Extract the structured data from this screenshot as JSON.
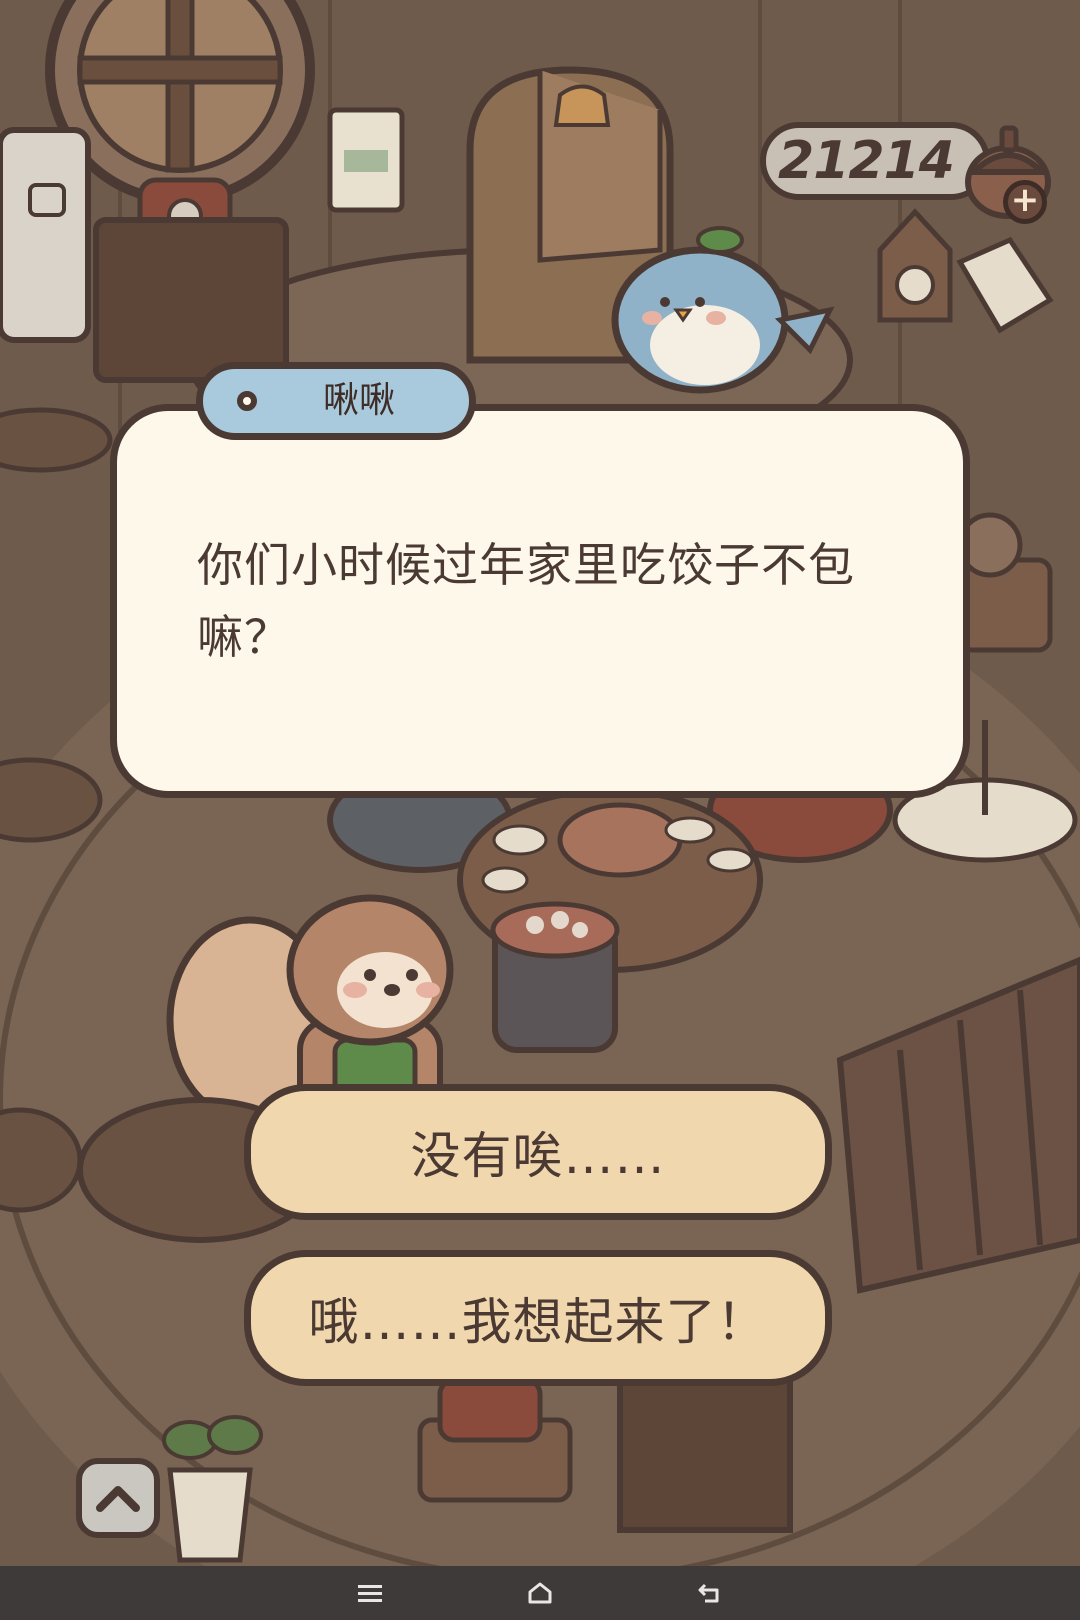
{
  "hud": {
    "currency": "21214",
    "add_button_label": "+",
    "currency_icon": "acorn-icon"
  },
  "dialog": {
    "speaker": "啾啾",
    "text": "你们小时候过年家里吃饺子不包嘛？"
  },
  "choices": [
    {
      "label": "没有唉……"
    },
    {
      "label": "哦……我想起来了！"
    }
  ],
  "expand_icon": "chevron-up-icon",
  "nav_bar": {
    "menu_icon": "menu-icon",
    "home_icon": "home-icon",
    "back_icon": "back-icon"
  },
  "colors": {
    "outline": "#4b3a33",
    "dialog_bg": "#fdf8ea",
    "name_tag_bg": "#a9c9dc",
    "choice_bg": "#f1d7ad",
    "currency_bg": "#c9c0b5",
    "nav_bg": "#3f3a3a"
  }
}
